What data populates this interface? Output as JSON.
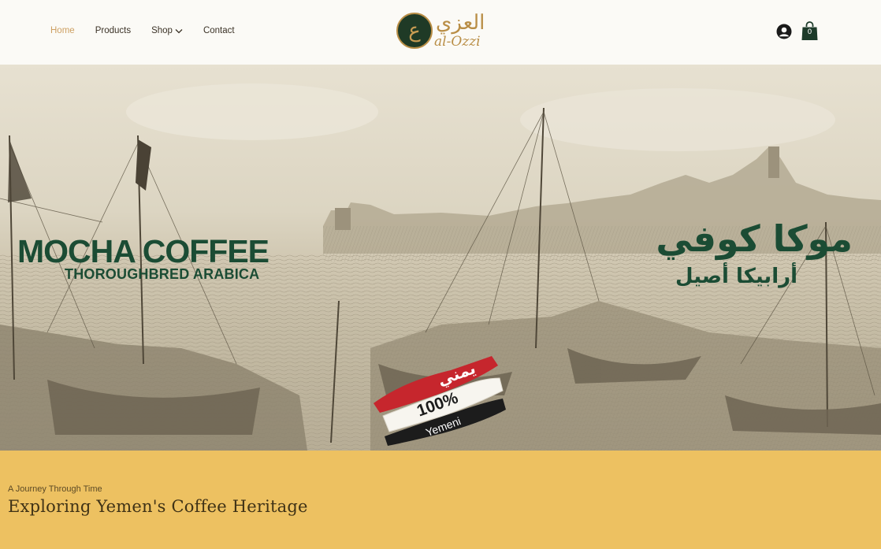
{
  "nav": {
    "items": [
      {
        "label": "Home",
        "active": true
      },
      {
        "label": "Products",
        "active": false
      },
      {
        "label": "Shop",
        "active": false,
        "has_dropdown": true
      },
      {
        "label": "Contact",
        "active": false
      }
    ]
  },
  "logo": {
    "arabic": "العزي",
    "latin": "al-Ozzi",
    "seal_glyph": "ع"
  },
  "header_icons": {
    "account": "user-account-icon",
    "cart": "shopping-bag-icon",
    "cart_count": "0"
  },
  "hero": {
    "title_en": "MOCHA COFFEE",
    "subtitle_en": "THOROUGHBRED ARABICA",
    "title_ar": "موكا كوفي",
    "subtitle_ar": "أرابيكا أصيل",
    "badge": {
      "top": "يمني",
      "middle": "100%",
      "bottom": "Yemeni"
    }
  },
  "heritage": {
    "kicker": "A Journey Through Time",
    "heading": "Exploring Yemen's Coffee Heritage"
  },
  "colors": {
    "brand_green": "#1b4c34",
    "brand_gold": "#b98e46",
    "nav_active": "#cda063",
    "band_yellow": "#edc161",
    "flag_red": "#c6262d",
    "flag_black": "#1c1c1c"
  }
}
